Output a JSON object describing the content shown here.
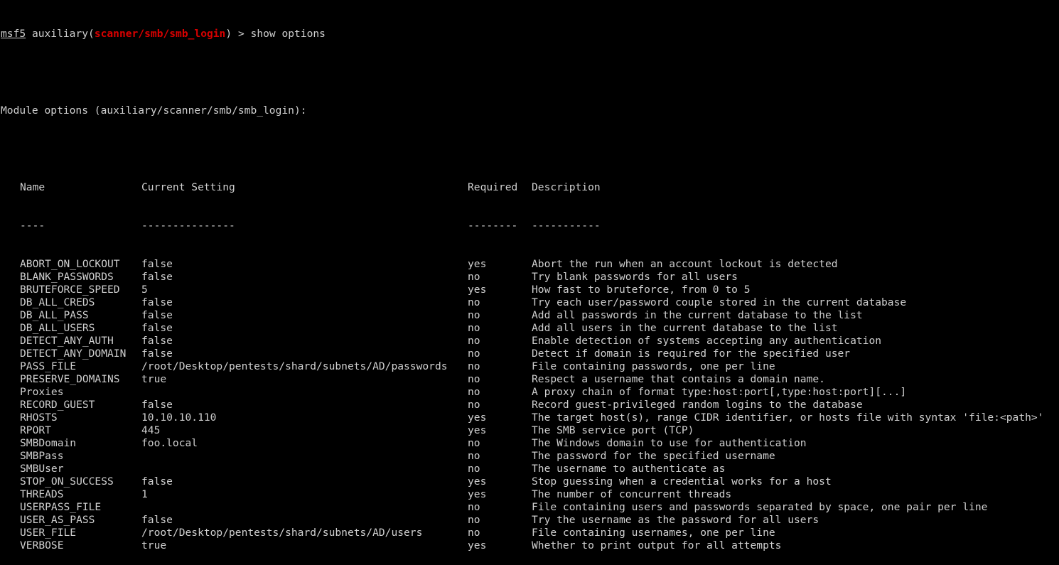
{
  "prompt": {
    "label": "msf5",
    "module_prefix": "auxiliary(",
    "module_path": "scanner/smb/smb_login",
    "module_suffix": ")",
    "arrow": ">",
    "command": "show options"
  },
  "section_title": "Module options (auxiliary/scanner/smb/smb_login):",
  "table": {
    "headers": {
      "name": "Name",
      "setting": "Current Setting",
      "required": "Required",
      "description": "Description"
    },
    "separators": {
      "name": "----",
      "setting": "---------------",
      "required": "--------",
      "description": "-----------"
    },
    "rows": [
      {
        "name": "ABORT_ON_LOCKOUT",
        "setting": "false",
        "required": "yes",
        "description": "Abort the run when an account lockout is detected"
      },
      {
        "name": "BLANK_PASSWORDS",
        "setting": "false",
        "required": "no",
        "description": "Try blank passwords for all users"
      },
      {
        "name": "BRUTEFORCE_SPEED",
        "setting": "5",
        "required": "yes",
        "description": "How fast to bruteforce, from 0 to 5"
      },
      {
        "name": "DB_ALL_CREDS",
        "setting": "false",
        "required": "no",
        "description": "Try each user/password couple stored in the current database"
      },
      {
        "name": "DB_ALL_PASS",
        "setting": "false",
        "required": "no",
        "description": "Add all passwords in the current database to the list"
      },
      {
        "name": "DB_ALL_USERS",
        "setting": "false",
        "required": "no",
        "description": "Add all users in the current database to the list"
      },
      {
        "name": "DETECT_ANY_AUTH",
        "setting": "false",
        "required": "no",
        "description": "Enable detection of systems accepting any authentication"
      },
      {
        "name": "DETECT_ANY_DOMAIN",
        "setting": "false",
        "required": "no",
        "description": "Detect if domain is required for the specified user"
      },
      {
        "name": "PASS_FILE",
        "setting": "/root/Desktop/pentests/shard/subnets/AD/passwords",
        "required": "no",
        "description": "File containing passwords, one per line"
      },
      {
        "name": "PRESERVE_DOMAINS",
        "setting": "true",
        "required": "no",
        "description": "Respect a username that contains a domain name."
      },
      {
        "name": "Proxies",
        "setting": "",
        "required": "no",
        "description": "A proxy chain of format type:host:port[,type:host:port][...]"
      },
      {
        "name": "RECORD_GUEST",
        "setting": "false",
        "required": "no",
        "description": "Record guest-privileged random logins to the database"
      },
      {
        "name": "RHOSTS",
        "setting": "10.10.10.110",
        "required": "yes",
        "description": "The target host(s), range CIDR identifier, or hosts file with syntax 'file:<path>'"
      },
      {
        "name": "RPORT",
        "setting": "445",
        "required": "yes",
        "description": "The SMB service port (TCP)"
      },
      {
        "name": "SMBDomain",
        "setting": "foo.local",
        "required": "no",
        "description": "The Windows domain to use for authentication"
      },
      {
        "name": "SMBPass",
        "setting": "",
        "required": "no",
        "description": "The password for the specified username"
      },
      {
        "name": "SMBUser",
        "setting": "",
        "required": "no",
        "description": "The username to authenticate as"
      },
      {
        "name": "STOP_ON_SUCCESS",
        "setting": "false",
        "required": "yes",
        "description": "Stop guessing when a credential works for a host"
      },
      {
        "name": "THREADS",
        "setting": "1",
        "required": "yes",
        "description": "The number of concurrent threads"
      },
      {
        "name": "USERPASS_FILE",
        "setting": "",
        "required": "no",
        "description": "File containing users and passwords separated by space, one pair per line"
      },
      {
        "name": "USER_AS_PASS",
        "setting": "false",
        "required": "no",
        "description": "Try the username as the password for all users"
      },
      {
        "name": "USER_FILE",
        "setting": "/root/Desktop/pentests/shard/subnets/AD/users",
        "required": "no",
        "description": "File containing usernames, one per line"
      },
      {
        "name": "VERBOSE",
        "setting": "true",
        "required": "yes",
        "description": "Whether to print output for all attempts"
      }
    ]
  },
  "colors": {
    "background": "#000000",
    "text": "#cfcfcf",
    "module_highlight": "#d80000"
  }
}
